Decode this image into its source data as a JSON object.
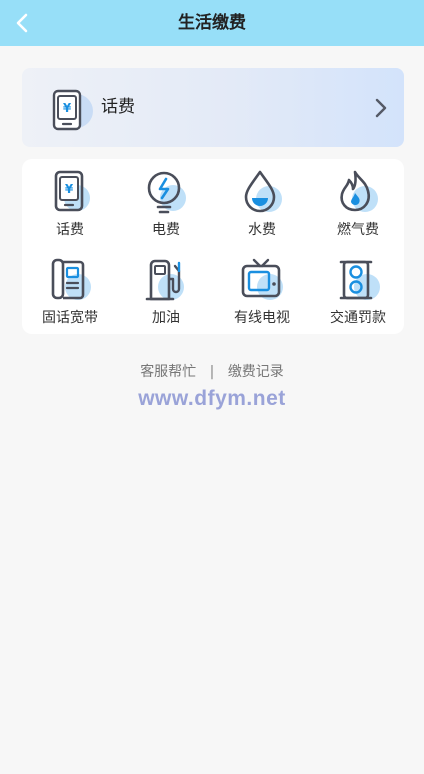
{
  "header": {
    "title": "生活缴费"
  },
  "banner": {
    "label": "话费",
    "icon": "phone-yuan-icon"
  },
  "services": [
    {
      "label": "话费",
      "icon": "phone-yuan-icon"
    },
    {
      "label": "电费",
      "icon": "bulb-lightning-icon"
    },
    {
      "label": "水费",
      "icon": "water-drop-icon"
    },
    {
      "label": "燃气费",
      "icon": "flame-icon"
    },
    {
      "label": "固话宽带",
      "icon": "landline-phone-icon"
    },
    {
      "label": "加油",
      "icon": "fuel-pump-icon"
    },
    {
      "label": "有线电视",
      "icon": "tv-icon"
    },
    {
      "label": "交通罚款",
      "icon": "traffic-light-icon"
    }
  ],
  "footer": {
    "service_link": "客服帮忙",
    "separator": "|",
    "records_link": "缴费记录"
  },
  "watermark": "www.dfym.net",
  "colors": {
    "header_bg": "#97dff8",
    "icon_stroke": "#4a4e5a",
    "icon_accent": "#1a8fe0",
    "icon_bubble": "#bfe0f8"
  }
}
